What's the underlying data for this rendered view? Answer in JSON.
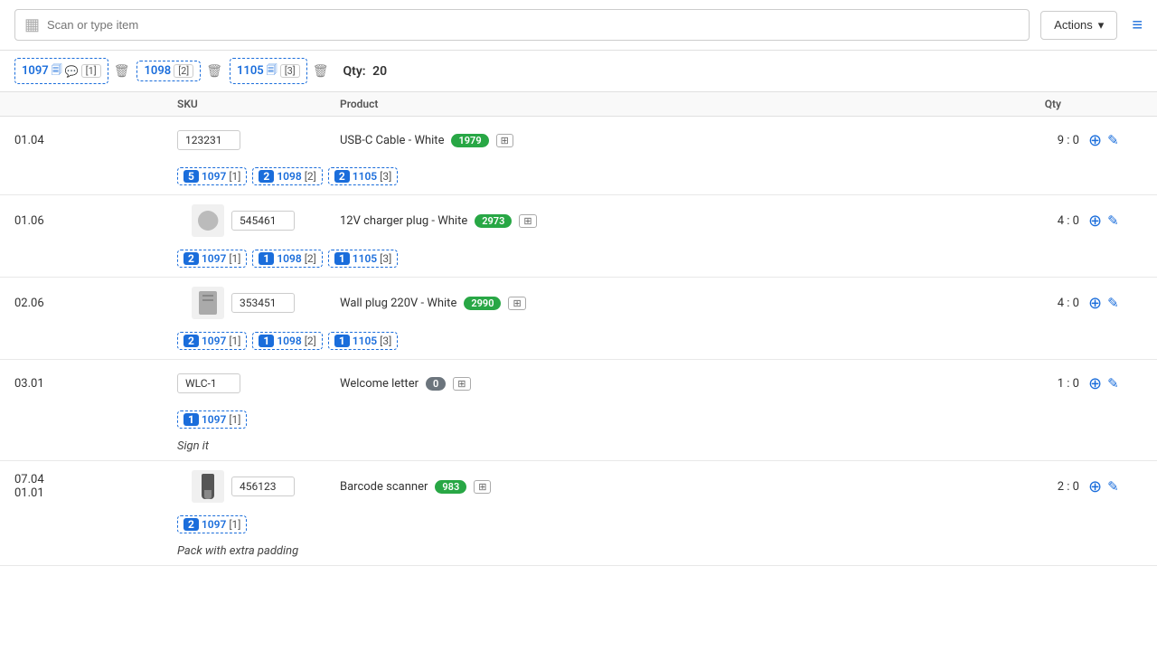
{
  "topbar": {
    "scan_placeholder": "Scan or type item",
    "actions_label": "Actions",
    "qty_label": "Qty:",
    "qty_value": "20"
  },
  "tabs": [
    {
      "id": "1097",
      "icons": [
        "file",
        "chat"
      ],
      "badge": "1",
      "has_delete": true
    },
    {
      "id": "1098",
      "badge": "2",
      "has_delete": true
    },
    {
      "id": "1105",
      "icons": [
        "file"
      ],
      "badge": "3",
      "has_delete": true
    }
  ],
  "table": {
    "headers": [
      "",
      "SKU",
      "Product",
      "Qty",
      ""
    ]
  },
  "rows": [
    {
      "pos": "01.04",
      "has_thumb": false,
      "sku": "123231",
      "name": "USB-C Cable - White",
      "badge": "1979",
      "badge_type": "green",
      "qty": "9 : 0",
      "tags": [
        {
          "num": "5",
          "id": "1097",
          "bracket": "[1]"
        },
        {
          "num": "2",
          "id": "1098",
          "bracket": "[2]"
        },
        {
          "num": "2",
          "id": "1105",
          "bracket": "[3]"
        }
      ],
      "note": null
    },
    {
      "pos": "01.06",
      "has_thumb": true,
      "thumb_type": "plug",
      "sku": "545461",
      "name": "12V charger plug - White",
      "badge": "2973",
      "badge_type": "green",
      "qty": "4 : 0",
      "tags": [
        {
          "num": "2",
          "id": "1097",
          "bracket": "[1]"
        },
        {
          "num": "1",
          "id": "1098",
          "bracket": "[2]"
        },
        {
          "num": "1",
          "id": "1105",
          "bracket": "[3]"
        }
      ],
      "note": null
    },
    {
      "pos": "02.06",
      "has_thumb": true,
      "thumb_type": "doc",
      "sku": "353451",
      "name": "Wall plug 220V - White",
      "badge": "2990",
      "badge_type": "green",
      "qty": "4 : 0",
      "tags": [
        {
          "num": "2",
          "id": "1097",
          "bracket": "[1]"
        },
        {
          "num": "1",
          "id": "1098",
          "bracket": "[2]"
        },
        {
          "num": "1",
          "id": "1105",
          "bracket": "[3]"
        }
      ],
      "note": null
    },
    {
      "pos": "03.01",
      "has_thumb": false,
      "sku": "WLC-1",
      "name": "Welcome letter",
      "badge": "0",
      "badge_type": "gray",
      "qty": "1 : 0",
      "tags": [
        {
          "num": "1",
          "id": "1097",
          "bracket": "[1]"
        }
      ],
      "note": "Sign it"
    },
    {
      "pos_lines": [
        "07.04",
        "01.01"
      ],
      "has_thumb": true,
      "thumb_type": "scanner",
      "sku": "456123",
      "name": "Barcode scanner",
      "badge": "983",
      "badge_type": "green",
      "qty": "2 : 0",
      "tags": [
        {
          "num": "2",
          "id": "1097",
          "bracket": "[1]"
        }
      ],
      "note": "Pack with extra padding"
    }
  ],
  "icons": {
    "barcode": "▦",
    "chevron_down": "▾",
    "plus_circle": "⊕",
    "pencil": "✎",
    "hamburger": "≡",
    "file": "🗐",
    "chat": "💬",
    "trash": "🗑",
    "expand": "⊞"
  }
}
